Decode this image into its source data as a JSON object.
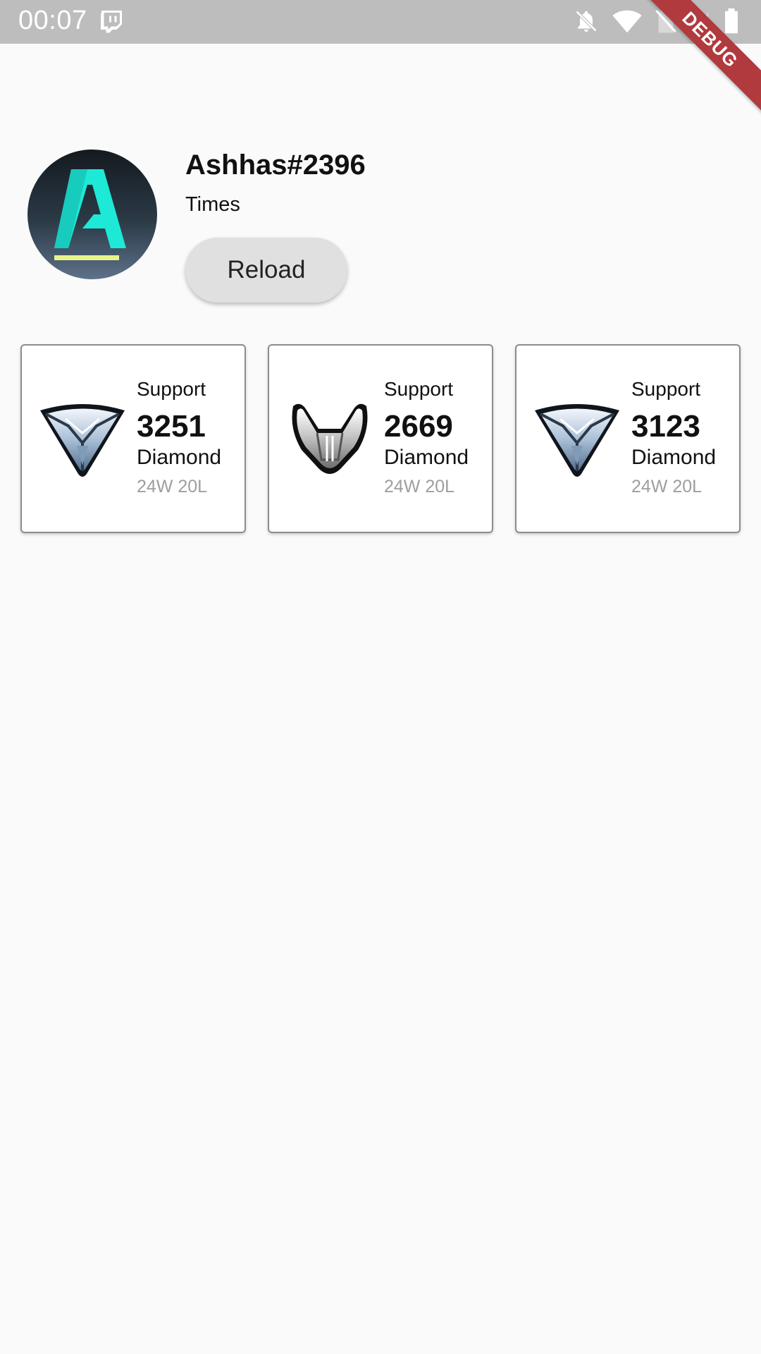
{
  "status_bar": {
    "time": "00:07",
    "app_icon": "twitch-icon",
    "icons": [
      "notifications-off-icon",
      "wifi-icon",
      "no-sim-icon",
      "signal-icon",
      "battery-icon"
    ]
  },
  "debug_banner": "DEBUG",
  "profile": {
    "name": "Ashhas#2396",
    "team": "Times",
    "reload_label": "Reload",
    "avatar_letter": "A"
  },
  "cards": [
    {
      "role": "Support",
      "sr": "3251",
      "tier": "Diamond",
      "record": "24W 20L",
      "icon": "diamond-rank-icon"
    },
    {
      "role": "Support",
      "sr": "2669",
      "tier": "Diamond",
      "record": "24W 20L",
      "icon": "silver-rank-icon"
    },
    {
      "role": "Support",
      "sr": "3123",
      "tier": "Diamond",
      "record": "24W 20L",
      "icon": "diamond-rank-icon"
    }
  ],
  "colors": {
    "status_bar": "#bdbdbd",
    "background": "#fafafa",
    "debug_banner": "#b03a3e",
    "avatar_accent": "#1de9d6",
    "avatar_underline": "#e8f58a"
  }
}
